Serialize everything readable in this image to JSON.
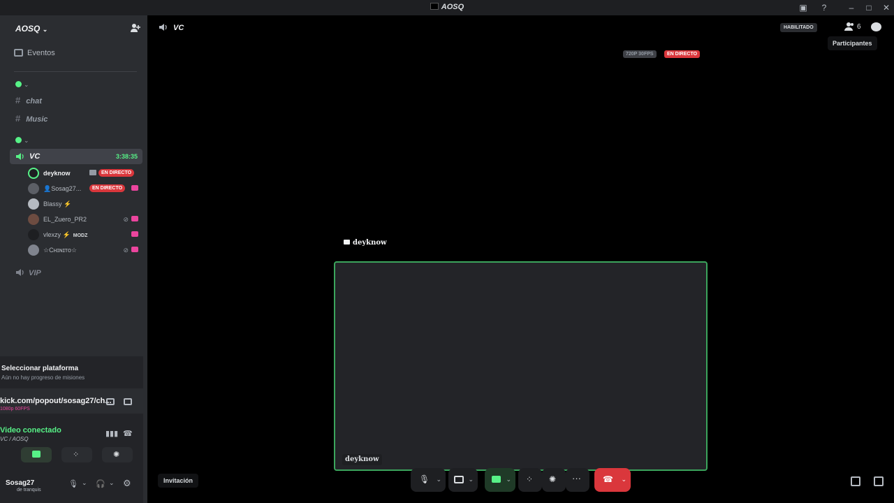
{
  "window": {
    "title": "AOSQ"
  },
  "sidebar": {
    "server_name": "AOSQ",
    "events_label": "Eventos",
    "channels": {
      "text": [
        {
          "name": "chat"
        },
        {
          "name": "Music"
        }
      ],
      "voice": {
        "name": "VC",
        "timer": "3:38:35",
        "members": [
          {
            "name": "deyknow",
            "live": "EN DIRECTO"
          },
          {
            "name": "👤Sosag27...",
            "live": "EN DIRECTO"
          },
          {
            "name": "Blassy"
          },
          {
            "name": "EL_Zuero_PR2"
          },
          {
            "name": "vlexzy",
            "tag": "MODZ"
          },
          {
            "name": "☆Cʜɪɴɪᴛᴏ☆"
          }
        ]
      },
      "vip": {
        "name": "VIP"
      }
    }
  },
  "panel": {
    "quest_title": "Seleccionar plataforma",
    "quest_sub": "Aún no hay progreso de misiones",
    "stream_url": "kick.com/popout/sosag27/ch...",
    "stream_quality": "1080p 60FPS",
    "rtc_title": "Video conectado",
    "rtc_sub": "VC / AOSQ",
    "user_name": "Sosag27",
    "user_status": "de tranquis"
  },
  "main": {
    "channel_title": "VC",
    "habilitado": "HABILITADO",
    "participant_count": "6",
    "tooltip": "Participantes",
    "quality_badge": "720P 30FPS",
    "live_badge": "EN DIRECTO",
    "stage_label": "deyknow",
    "tile_name": "deyknow",
    "invite_tooltip": "Invitación"
  },
  "colors": {
    "green": "#57f287",
    "live_red": "#da373c",
    "accent_pink": "#eb459e",
    "tile_border": "#3ba55c"
  }
}
